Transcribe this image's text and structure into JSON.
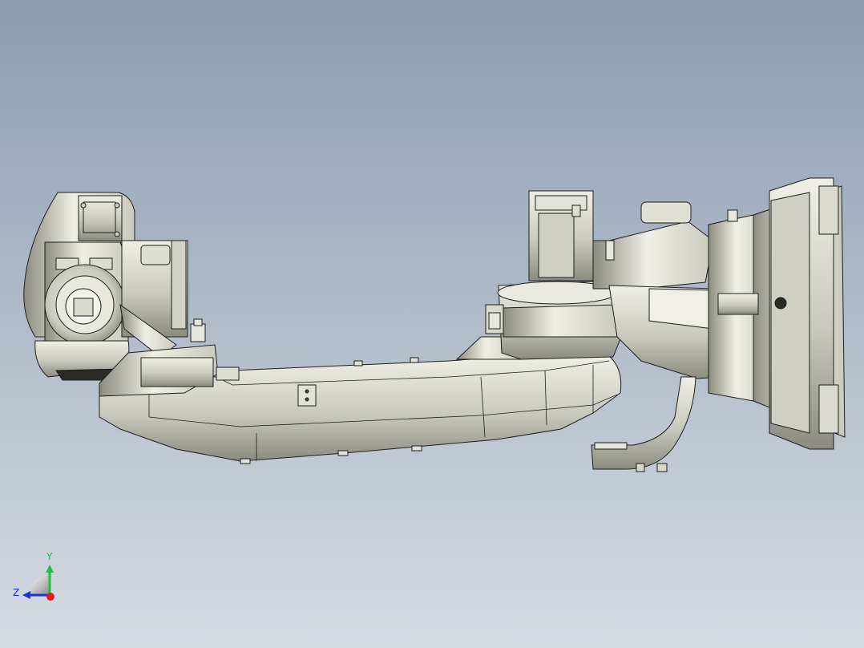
{
  "viewport": {
    "background_top": "#8c9db2",
    "background_bottom": "#d6dbe2"
  },
  "model": {
    "shade_light": "#efefe6",
    "shade_mid": "#c9c9bd",
    "shade_dark": "#8b8b80",
    "edge": "#1e1e1e"
  },
  "triad": {
    "y_label": "Y",
    "z_label": "Z",
    "y_color": "#19c43a",
    "z_color": "#1a33d6",
    "x_color": "#e01b1b",
    "y_icon": "arrow-up-icon",
    "z_icon": "arrow-left-icon",
    "x_icon": "dot-icon"
  }
}
